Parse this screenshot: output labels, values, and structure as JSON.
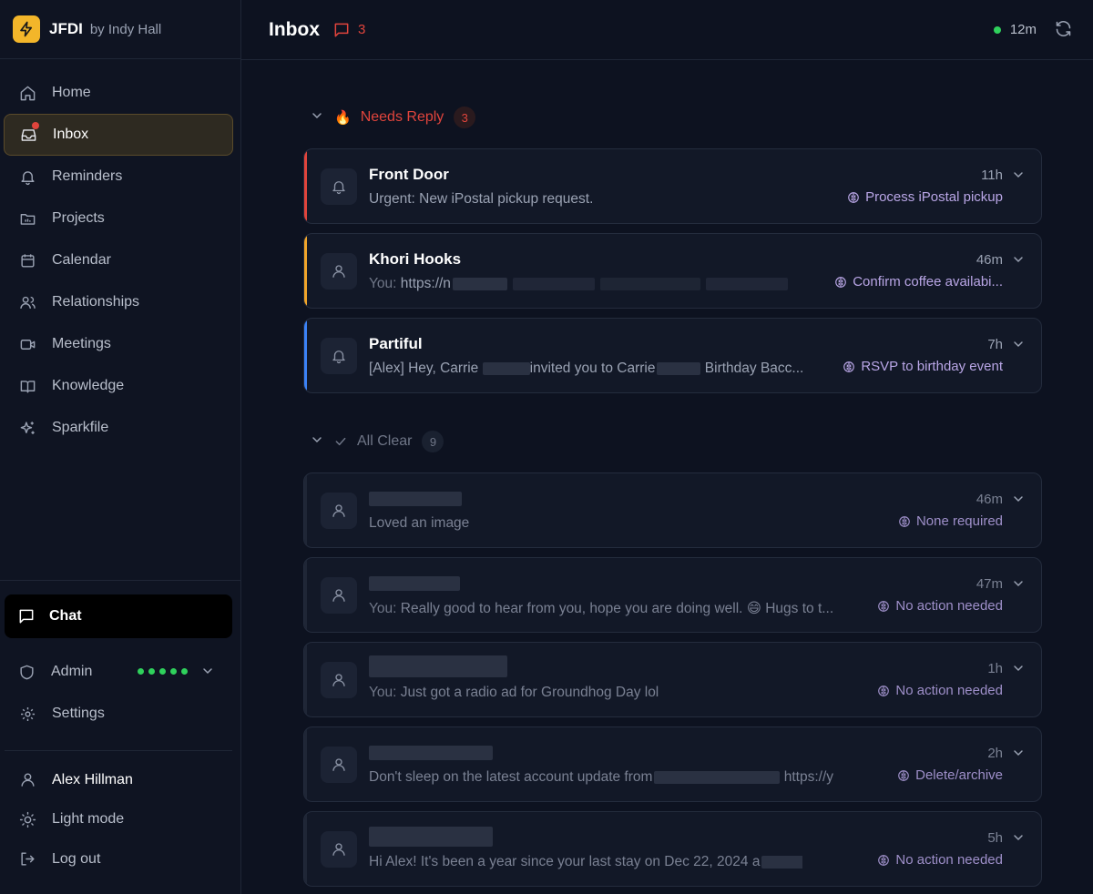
{
  "brand": {
    "name": "JFDI",
    "sub": "by Indy Hall"
  },
  "nav": [
    {
      "label": "Home",
      "icon": "home-icon"
    },
    {
      "label": "Inbox",
      "icon": "inbox-icon",
      "active": true
    },
    {
      "label": "Reminders",
      "icon": "bell-icon"
    },
    {
      "label": "Projects",
      "icon": "folder-icon"
    },
    {
      "label": "Calendar",
      "icon": "calendar-icon"
    },
    {
      "label": "Relationships",
      "icon": "users-icon"
    },
    {
      "label": "Meetings",
      "icon": "video-icon"
    },
    {
      "label": "Knowledge",
      "icon": "book-icon"
    },
    {
      "label": "Sparkfile",
      "icon": "sparkles-icon"
    }
  ],
  "chat": {
    "label": "Chat"
  },
  "admin": {
    "label": "Admin"
  },
  "settings": {
    "label": "Settings"
  },
  "footer": {
    "user": "Alex Hillman",
    "theme": "Light mode",
    "logout": "Log out"
  },
  "header": {
    "title": "Inbox",
    "badge_count": "3",
    "status_time": "12m"
  },
  "sections": {
    "needs_reply": {
      "emoji": "🔥",
      "title": "Needs Reply",
      "count": "3"
    },
    "all_clear": {
      "title": "All Clear",
      "count": "9"
    }
  },
  "cards_needs": [
    {
      "name": "Front Door",
      "preview": "Urgent: New iPostal pickup request.",
      "time": "11h",
      "action": "Process iPostal pickup",
      "accent": "#e0443c",
      "icon": "bell-icon"
    },
    {
      "name": "Khori Hooks",
      "prefix": "You:",
      "preview": "https://n",
      "time": "46m",
      "action": "Confirm coffee availabi...",
      "accent": "#f0a52a",
      "icon": "user-icon"
    },
    {
      "name": "Partiful",
      "preview": "[Alex] Hey, Carrie",
      "preview_mid": "invited you to Carrie",
      "preview_end": "Birthday Bacc...",
      "time": "7h",
      "action": "RSVP to birthday event",
      "accent": "#3b82f6",
      "icon": "bell-icon"
    }
  ],
  "cards_clear": [
    {
      "preview": "Loved an image",
      "time": "46m",
      "action": "None required"
    },
    {
      "prefix": "You:",
      "preview": "Really good to hear from you, hope you are doing well. 😄 Hugs to t...",
      "time": "47m",
      "action": "No action needed"
    },
    {
      "prefix": "You:",
      "preview": "Just got a radio ad for Groundhog Day lol",
      "time": "1h",
      "action": "No action needed"
    },
    {
      "preview": "Don't sleep on the latest account update from",
      "preview_end": "https://yo...",
      "time": "2h",
      "action": "Delete/archive"
    },
    {
      "preview": "Hi Alex! It's been a year since your last stay on Dec 22, 2024 a",
      "time": "5h",
      "action": "No action needed"
    }
  ],
  "colors": {
    "accent_brand": "#f3b62a",
    "alert": "#e0443c",
    "ok": "#2fd15c",
    "ai_action": "#b9a6e6"
  }
}
